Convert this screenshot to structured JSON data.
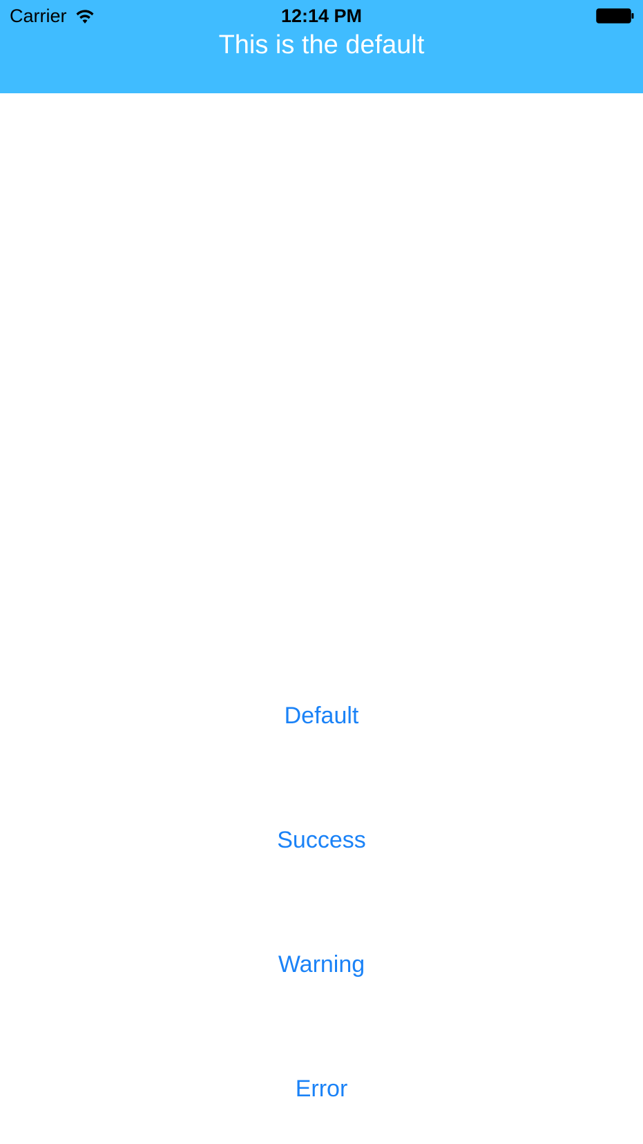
{
  "status_bar": {
    "carrier": "Carrier",
    "time": "12:14 PM",
    "wifi_icon": "wifi-icon",
    "battery_icon": "battery-icon"
  },
  "banner": {
    "title": "This is the default",
    "background_color": "#40bcff",
    "text_color": "#ffffff"
  },
  "buttons": [
    {
      "label": "Default"
    },
    {
      "label": "Success"
    },
    {
      "label": "Warning"
    },
    {
      "label": "Error"
    }
  ],
  "colors": {
    "button_text": "#1a82f7",
    "page_background": "#ffffff"
  }
}
